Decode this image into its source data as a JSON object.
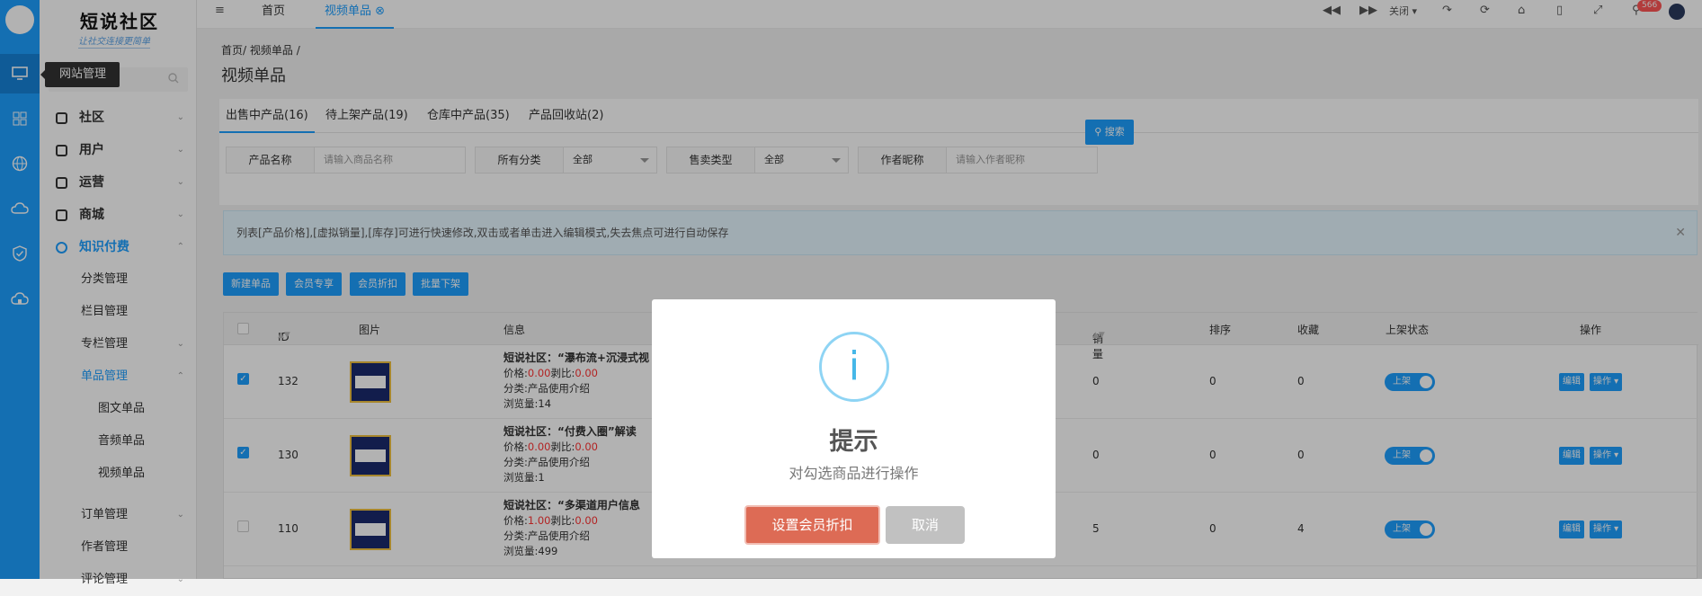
{
  "brand": {
    "name": "短说社区",
    "slogan": "让社交连接更简单"
  },
  "tooltip": "网站管理",
  "rail_icons": [
    "monitor-icon",
    "grid-icon",
    "globe-icon",
    "cloud-icon",
    "shield-check-icon",
    "cloud-home-icon"
  ],
  "menu": {
    "items": [
      {
        "label": "社区"
      },
      {
        "label": "用户"
      },
      {
        "label": "运营"
      },
      {
        "label": "商城"
      },
      {
        "label": "知识付费"
      }
    ],
    "sub": [
      "分类管理",
      "栏目管理",
      "专栏管理",
      "单品管理"
    ],
    "sub2": [
      "图文单品",
      "音频单品",
      "视频单品"
    ],
    "after": [
      "订单管理",
      "作者管理",
      "评论管理"
    ]
  },
  "topbar": {
    "tab_home": "首页",
    "tab_video": "视频单品",
    "close_label": "关闭",
    "badge": "566"
  },
  "breadcrumb": {
    "home": "首页",
    "sep": "/",
    "current": "视频单品",
    "trail": "/"
  },
  "page_title": "视频单品",
  "tabs": [
    "出售中产品(16)",
    "待上架产品(19)",
    "仓库中产品(35)",
    "产品回收站(2)"
  ],
  "filters": {
    "name_label": "产品名称",
    "name_placeholder": "请输入商品名称",
    "cat_label": "所有分类",
    "cat_value": "全部",
    "sale_label": "售卖类型",
    "sale_value": "全部",
    "author_label": "作者昵称",
    "author_placeholder": "请输入作者昵称",
    "search": "搜索"
  },
  "alert": "列表[产品价格],[虚拟销量],[库存]可进行快速修改,双击或者单击进入编辑模式,失去焦点可进行自动保存",
  "actions": [
    "新建单品",
    "会员专享",
    "会员折扣",
    "批量下架"
  ],
  "table": {
    "headers": {
      "id": "ID",
      "img": "图片",
      "info": "信息",
      "sales": "销量",
      "sort": "排序",
      "fav": "收藏",
      "status": "上架状态",
      "op": "操作"
    },
    "rows": [
      {
        "checked": true,
        "id": "132",
        "title": "短说社区：“瀑布流+沉浸式视",
        "price_label": "价格:",
        "price": "0.00",
        "ratio_label": "剥比:",
        "ratio": "0.00",
        "cat": "分类:产品使用介绍",
        "views": "浏览量:14",
        "sales": "0",
        "sort": "0",
        "fav": "0"
      },
      {
        "checked": true,
        "id": "130",
        "title": "短说社区：“付费入圈”解读",
        "price_label": "价格:",
        "price": "0.00",
        "ratio_label": "剥比:",
        "ratio": "0.00",
        "cat": "分类:产品使用介绍",
        "views": "浏览量:1",
        "sales": "0",
        "sort": "0",
        "fav": "0"
      },
      {
        "checked": false,
        "id": "110",
        "title": "短说社区：“多渠道用户信息",
        "price_label": "价格:",
        "price": "1.00",
        "ratio_label": "剥比:",
        "ratio": "0.00",
        "cat": "分类:产品使用介绍",
        "views": "浏览量:499",
        "sales": "5",
        "sort": "0",
        "fav": "4"
      }
    ],
    "status_label": "上架",
    "edit_label": "编辑",
    "op_label": "操作"
  },
  "modal": {
    "icon": "i",
    "title": "提示",
    "message": "对勾选商品进行操作",
    "confirm": "设置会员折扣",
    "cancel": "取消"
  },
  "colors": {
    "primary": "#1e9fff",
    "danger": "#dd6b55"
  }
}
